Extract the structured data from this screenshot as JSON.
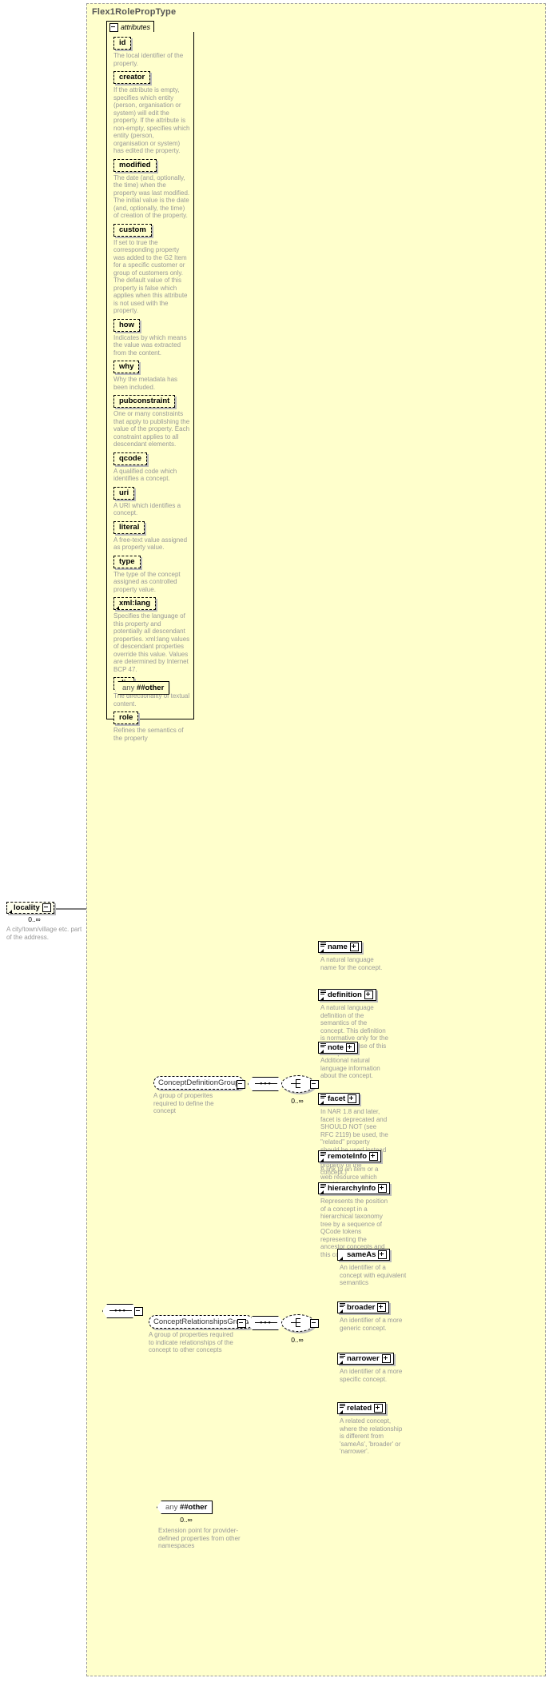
{
  "type_panel": {
    "title": "Flex1RolePropType"
  },
  "attributes_compartment": {
    "tab_label": "attributes",
    "items": [
      {
        "name": "id",
        "desc": "The local identifier of the property."
      },
      {
        "name": "creator",
        "desc": "If the attribute is empty, specifies which entity (person, organisation or system) will edit the property. If the attribute is non-empty, specifies which entity (person, organisation or system) has edited the property."
      },
      {
        "name": "modified",
        "desc": "The date (and, optionally, the time) when the property was last modified. The initial value is the date (and, optionally, the time) of creation of the property."
      },
      {
        "name": "custom",
        "desc": "If set to true the corresponding property was added to the G2 Item for a specific customer or group of customers only. The default value of this property is false which applies when this attribute is not used with the property."
      },
      {
        "name": "how",
        "desc": "Indicates by which means the value was extracted from the content."
      },
      {
        "name": "why",
        "desc": "Why the metadata has been included."
      },
      {
        "name": "pubconstraint",
        "desc": "One or many constraints that apply to publishing the value of the property. Each constraint applies to all descendant elements."
      },
      {
        "name": "qcode",
        "desc": "A qualified code which identifies a concept."
      },
      {
        "name": "uri",
        "desc": "A URI which identifies a concept."
      },
      {
        "name": "literal",
        "desc": "A free-text value assigned as property value."
      },
      {
        "name": "type",
        "desc": "The type of the concept assigned as controlled property value."
      },
      {
        "name": "xml:lang",
        "desc": "Specifies the language of this property and potentially all descendant properties. xml:lang values of descendant properties override this value. Values are determined by Internet BCP 47."
      },
      {
        "name": "dir",
        "desc": "The directionality of textual content."
      },
      {
        "name": "role",
        "desc": "Refines the semantics of the property"
      }
    ],
    "any_wildcard": {
      "label": "any",
      "namespace": "##other"
    }
  },
  "locality": {
    "name": "locality",
    "occurs": "0..∞",
    "desc": "A city/town/village etc. part of the address."
  },
  "concept_definition_group": {
    "name": "ConceptDefinitionGroup",
    "desc": "A group of properites required to define the concept",
    "occurs": "0..∞",
    "children": [
      {
        "name": "name",
        "desc": "A natural language name for the concept."
      },
      {
        "name": "definition",
        "desc": "A natural language definition of the semantics of the concept. This definition is normative only for the scope of the use of this concept."
      },
      {
        "name": "note",
        "desc": "Additional natural language information about the concept."
      },
      {
        "name": "facet",
        "desc": "In NAR 1.8 and later, facet is deprecated and SHOULD NOT (see RFC 2119) be used, the \"related\" property should be used instead (was: An intrinsic property of the concept.)"
      },
      {
        "name": "remoteInfo",
        "desc": "A link to an item or a web resource which provides information about the concept"
      },
      {
        "name": "hierarchyInfo",
        "desc": "Represents the position of a concept in a hierarchical taxonomy tree by a sequence of QCode tokens representing the ancestor concepts and this concept"
      }
    ]
  },
  "concept_relationships_group": {
    "name": "ConceptRelationshipsGroup",
    "desc": "A group of properties required to indicate relationships of the concept to other concepts",
    "occurs": "0..∞",
    "children": [
      {
        "name": "sameAs",
        "desc": "An identifier of a concept with equivalent semantics"
      },
      {
        "name": "broader",
        "desc": "An identifier of a more generic concept."
      },
      {
        "name": "narrower",
        "desc": "An identifier of a more specific concept."
      },
      {
        "name": "related",
        "desc": "A related concept, where the relationship is different from 'sameAs', 'broader' or 'narrower'."
      }
    ]
  },
  "bottom_any": {
    "label": "any",
    "namespace": "##other",
    "occurs": "0..∞",
    "desc": "Extension point for provider-defined properties from other namespaces"
  },
  "colors": {
    "panel_background": "#ffffcc",
    "description_text": "#999999",
    "line": "#000000",
    "element_fill": "#ffffff"
  }
}
